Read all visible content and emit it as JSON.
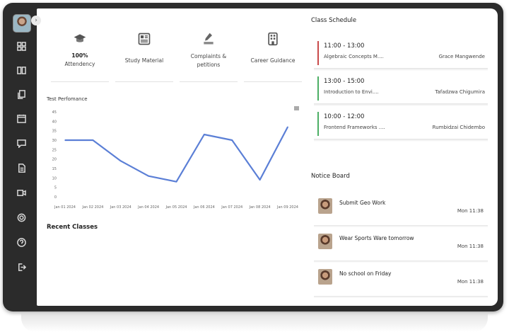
{
  "sidebar": {
    "collapse_glyph": "›",
    "icons": [
      "grid-icon",
      "book-icon",
      "copy-icon",
      "calendar-icon",
      "chat-icon",
      "document-icon",
      "video-icon",
      "settings-icon",
      "help-icon",
      "logout-icon"
    ]
  },
  "tiles": [
    {
      "icon": "graduation-cap-icon",
      "value": "100%",
      "label": "Attendency"
    },
    {
      "icon": "newspaper-icon",
      "label": "Study Material"
    },
    {
      "icon": "writing-hand-icon",
      "label": "Complaints & petitions"
    },
    {
      "icon": "building-icon",
      "label": "Career Guidance"
    }
  ],
  "chart_title": "Test Perfomance",
  "chart_data": {
    "type": "line",
    "title": "Test Perfomance",
    "categories": [
      "Jan 01 2024",
      "Jan 02 2024",
      "Jan 03 2024",
      "Jan 04 2024",
      "Jan 05 2024",
      "Jan 06 2024",
      "Jan 07 2024",
      "Jan 08 2024",
      "Jan 09 2024"
    ],
    "values": [
      30,
      30,
      19,
      11,
      8,
      33,
      30,
      9,
      37
    ],
    "yticks": [
      0,
      5,
      10,
      15,
      20,
      25,
      30,
      35,
      40,
      45
    ],
    "ylim": [
      0,
      45
    ],
    "grid": false,
    "color": "#5b7fd6"
  },
  "recent_classes_title": "Recent Classes",
  "schedule": {
    "title": "Class Schedule",
    "items": [
      {
        "time": "11:00 - 13:00",
        "course": "Algebraic Concepts M....",
        "teacher": "Grace Mangwende",
        "color": "#c94a4a"
      },
      {
        "time": "13:00 - 15:00",
        "course": "Introduction to Envi....",
        "teacher": "Tafadzwa Chigumira",
        "color": "#4caf65"
      },
      {
        "time": "10:00 - 12:00",
        "course": "Frontend Frameworks ....",
        "teacher": "Rumbidzai Chidembo",
        "color": "#4caf65"
      }
    ]
  },
  "notices": {
    "title": "Notice Board",
    "items": [
      {
        "message": "Submit Geo Work",
        "time": "Mon 11:38"
      },
      {
        "message": "Wear Sports Ware tomorrow",
        "time": "Mon 11:38"
      },
      {
        "message": "No school on Friday",
        "time": "Mon 11:38"
      }
    ]
  }
}
